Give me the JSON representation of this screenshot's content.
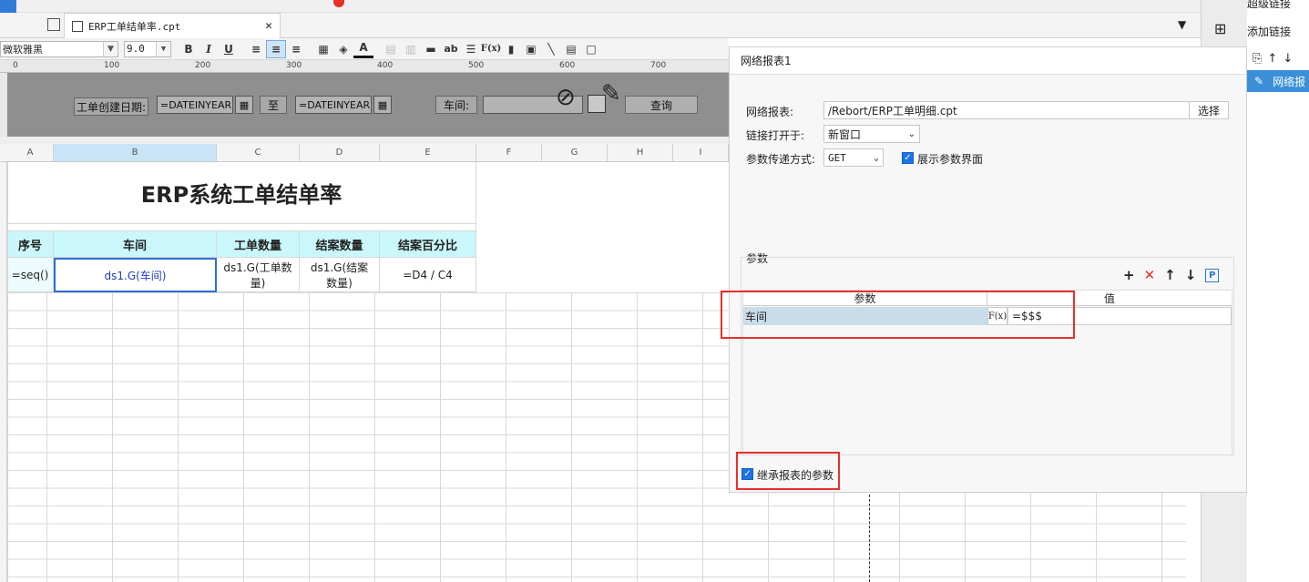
{
  "file_tab": {
    "name": "ERP工单结单率.cpt"
  },
  "toolbar": {
    "font_family": "微软雅黑",
    "font_size": "9.0",
    "bold": "B",
    "italic": "I",
    "underline": "U",
    "ab": "ab",
    "fx": "F(x)"
  },
  "ruler": {
    "ticks": [
      "0",
      "100",
      "200",
      "300",
      "400",
      "500",
      "600",
      "700"
    ]
  },
  "params_bar": {
    "date_label": "工单创建日期:",
    "date_from": "=DATEINYEAR",
    "to_label": "至",
    "date_to": "=DATEINYEAR",
    "workshop_label": "车间:",
    "query_button": "查询"
  },
  "columns": [
    "A",
    "B",
    "C",
    "D",
    "E",
    "F",
    "G",
    "H",
    "I"
  ],
  "sheet": {
    "title": "ERP系统工单结单率",
    "headers": [
      "序号",
      "车间",
      "工单数量",
      "结案数量",
      "结案百分比"
    ],
    "row": [
      "=seq()",
      "ds1.G(车间)",
      "ds1.G(工单数量)",
      "ds1.G(结案数量)",
      "=D4 / C4"
    ]
  },
  "colors": {
    "header_bg": "#c9f7fb",
    "accent": "#1a73e8",
    "highlight": "#e8302a"
  },
  "dialog": {
    "title": "网络报表1",
    "report_label": "网络报表:",
    "report_value": "/Rebort/ERP工单明细.cpt",
    "select_button": "选择",
    "open_in_label": "链接打开于:",
    "open_in_value": "新窗口",
    "method_label": "参数传递方式:",
    "method_value": "GET",
    "show_params_label": "展示参数界面",
    "params_section": "参数",
    "table_headers": [
      "参数",
      "值"
    ],
    "param_row": {
      "name": "车间",
      "value": "=$$$"
    },
    "inherit_label": "继承报表的参数"
  },
  "right_panel": {
    "top_label": "超级链接",
    "add_link": "添加链接",
    "item": "网络报"
  }
}
